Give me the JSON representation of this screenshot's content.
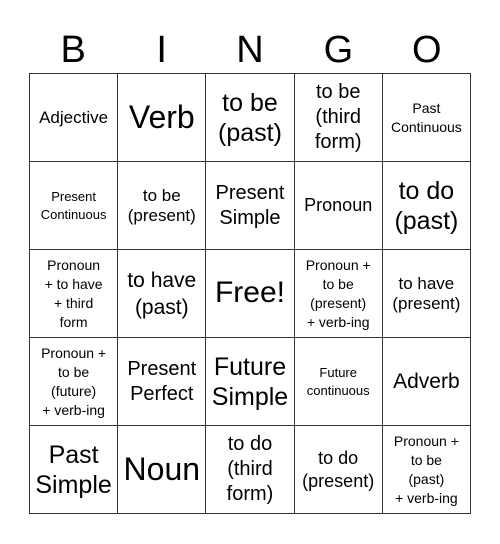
{
  "header": {
    "letters": [
      "B",
      "I",
      "N",
      "G",
      "O"
    ]
  },
  "board": {
    "cells": [
      [
        "Adjective",
        "Verb",
        "to be\n(past)",
        "to be\n(third\nform)",
        "Past\nContinuous"
      ],
      [
        "Present\nContinuous",
        "to be\n(present)",
        "Present\nSimple",
        "Pronoun",
        "to do\n(past)"
      ],
      [
        "Pronoun\n+ to have\n+ third\nform",
        "to have\n(past)",
        "Free!",
        "Pronoun +\nto be\n(present)\n+ verb-ing",
        "to have\n(present)"
      ],
      [
        "Pronoun +\nto be\n(future)\n+ verb-ing",
        "Present\nPerfect",
        "Future\nSimple",
        "Future\ncontinuous",
        "Adverb"
      ],
      [
        "Past\nSimple",
        "Noun",
        "to do\n(third\nform)",
        "to do\n(present)",
        "Pronoun +\nto be\n(past)\n+ verb-ing"
      ]
    ],
    "free_space": "Free!"
  }
}
